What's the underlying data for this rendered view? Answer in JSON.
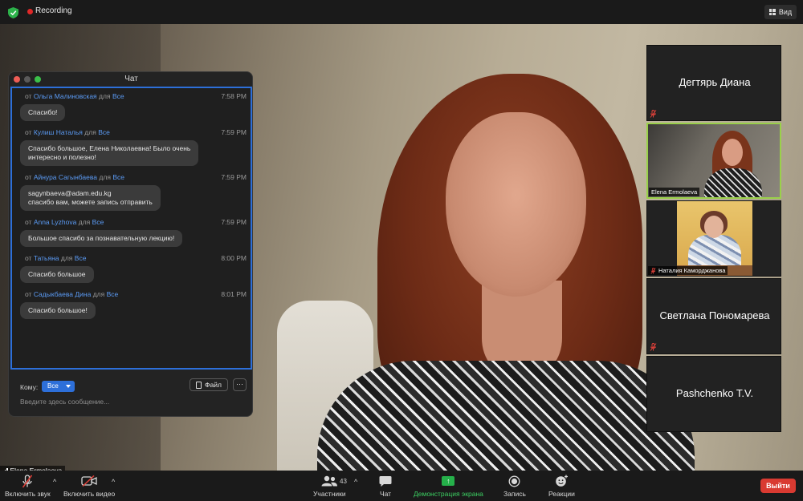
{
  "topbar": {
    "recording_label": "Recording",
    "view_label": "Вид",
    "icons": {
      "security": "shield-check-icon",
      "view": "grid-icon"
    },
    "colors": {
      "recording_dot": "#e02828",
      "shield": "#2cb24a"
    }
  },
  "chat": {
    "title": "Чат",
    "messages": [
      {
        "prefix": "от",
        "sender": "Ольга Малиновская",
        "for": "для",
        "target": "Все",
        "time": "7:58 PM",
        "lines": [
          "Спасибо!"
        ]
      },
      {
        "prefix": "от",
        "sender": "Кулиш Наталья",
        "for": "для",
        "target": "Все",
        "time": "7:59 PM",
        "lines": [
          "Спасибо большое, Елена Николаевна! Было очень",
          "интересно и полезно!"
        ]
      },
      {
        "prefix": "от",
        "sender": "Айнура Сагынбаева",
        "for": "для",
        "target": "Все",
        "time": "7:59 PM",
        "lines": [
          "sagynbaeva@adam.edu.kg",
          "спасибо вам, можете запись отправить"
        ]
      },
      {
        "prefix": "от",
        "sender": "Anna Lyzhova",
        "for": "для",
        "target": "Все",
        "time": "7:59 PM",
        "lines": [
          "Большое спасибо за познавательную лекцию!"
        ]
      },
      {
        "prefix": "от",
        "sender": "Татьяна",
        "for": "для",
        "target": "Все",
        "time": "8:00 PM",
        "lines": [
          "Спасибо большое"
        ]
      },
      {
        "prefix": "от",
        "sender": "Садыкбаева Дина",
        "for": "для",
        "target": "Все",
        "time": "8:01 PM",
        "lines": [
          "Спасибо большое!"
        ]
      }
    ],
    "to_label": "Кому:",
    "to_value": "Все",
    "file_label": "Файл",
    "more_label": "···",
    "input_placeholder": "Введите здесь сообщение...",
    "colors": {
      "accent": "#2d6fd9",
      "sender": "#5b9bf5"
    }
  },
  "participants": [
    {
      "name": "Дегтярь Диана",
      "muted": true,
      "video": false
    },
    {
      "name": "Elena Ermolaeva",
      "muted": false,
      "video": true,
      "active_speaker": true
    },
    {
      "name": "Наталия Каморджанова",
      "muted": true,
      "video": true
    },
    {
      "name": "Светлана Пономарева",
      "muted": true,
      "video": false
    },
    {
      "name": "Pashchenko T.V.",
      "muted": false,
      "video": false
    }
  ],
  "main_video": {
    "speaker_name": "Elena Ermolaeva"
  },
  "toolbar": {
    "unmute_label": "Включить звук",
    "start_video_label": "Включить видео",
    "participants_label": "Участники",
    "participants_count": "43",
    "chat_label": "Чат",
    "share_label": "Демонстрация экрана",
    "record_label": "Запись",
    "reactions_label": "Реакции",
    "leave_label": "Выйти",
    "colors": {
      "share": "#25b04a",
      "leave": "#d93a31",
      "share_text": "#3ccf62"
    }
  }
}
